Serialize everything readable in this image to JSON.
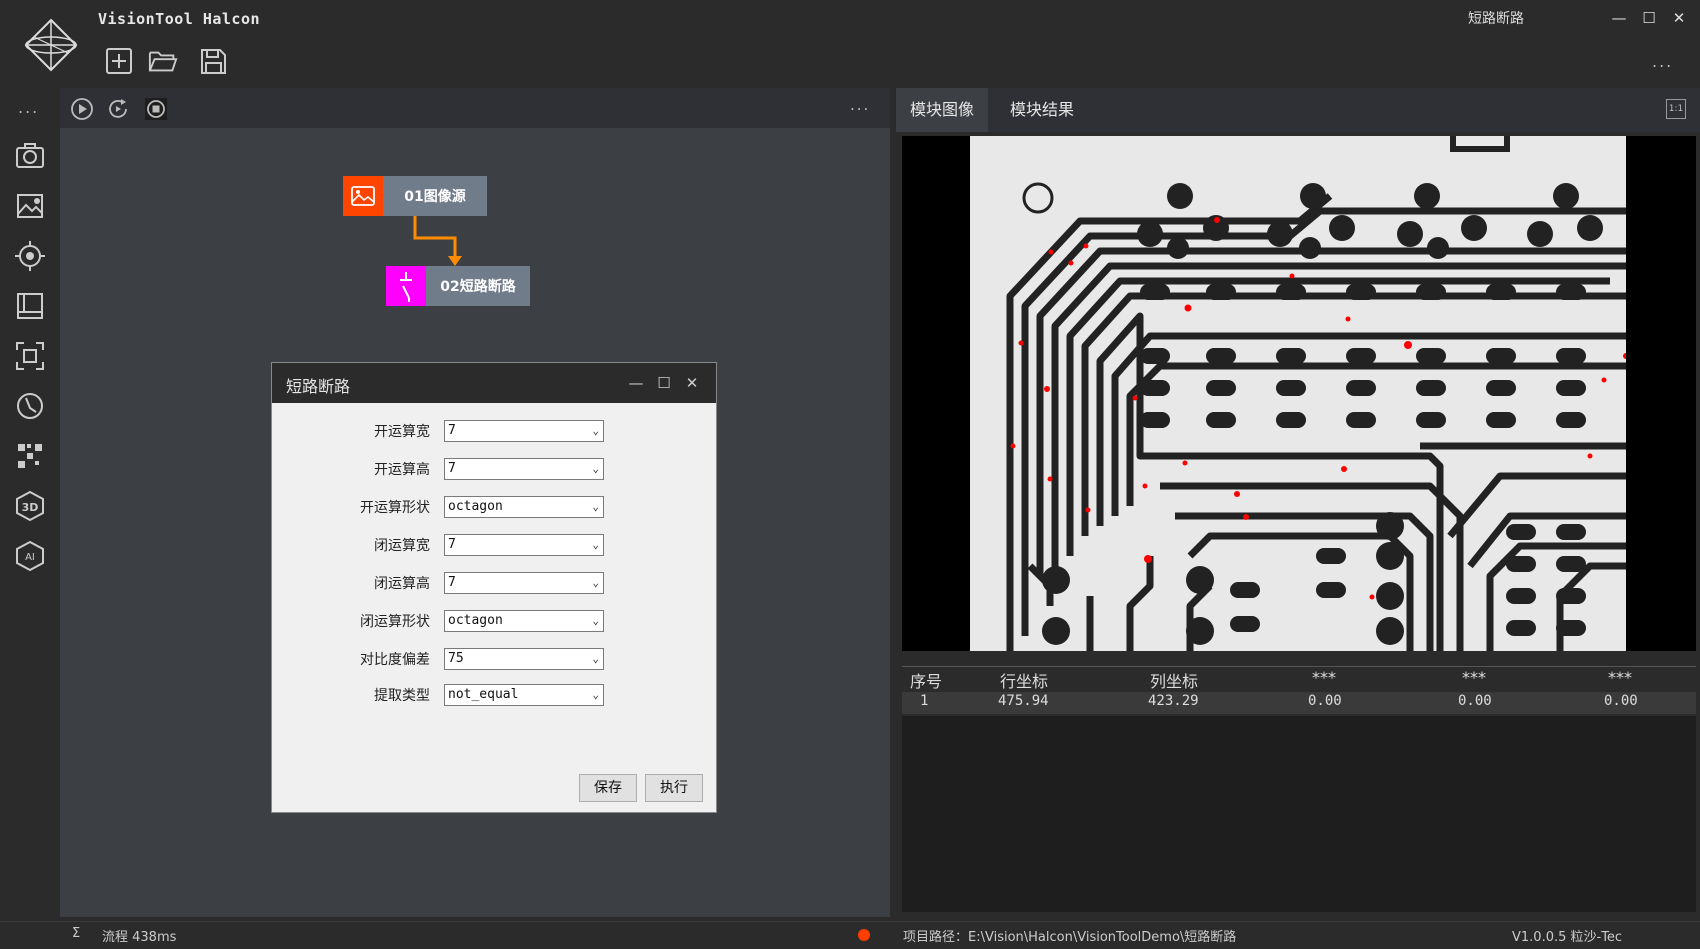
{
  "app": {
    "title": "VisionTool Halcon",
    "window_title": "短路断路"
  },
  "window_controls": {
    "minimize": "—",
    "maximize": "☐",
    "close": "✕"
  },
  "toolbar": {
    "more": "..."
  },
  "sidebar": {
    "more": "..."
  },
  "flow": {
    "more": "...",
    "nodes": [
      {
        "label": "01图像源",
        "color": "#ff4500"
      },
      {
        "label": "02短路断路",
        "color": "#ff00ff"
      }
    ]
  },
  "dialog": {
    "title": "短路断路",
    "controls": {
      "minimize": "—",
      "maximize": "☐",
      "close": "✕"
    },
    "rows": [
      {
        "label": "开运算宽",
        "value": "7"
      },
      {
        "label": "开运算高",
        "value": "7"
      },
      {
        "label": "开运算形状",
        "value": "octagon"
      },
      {
        "label": "闭运算宽",
        "value": "7"
      },
      {
        "label": "闭运算高",
        "value": "7"
      },
      {
        "label": "闭运算形状",
        "value": "octagon"
      },
      {
        "label": "对比度偏差",
        "value": "75"
      },
      {
        "label": "提取类型",
        "value": "not_equal"
      }
    ],
    "save": "保存",
    "execute": "执行",
    "arrow": "⌄"
  },
  "right": {
    "tabs": {
      "image": "模块图像",
      "result": "模块结果"
    },
    "ratio": "1:1",
    "table": {
      "headers": [
        "序号",
        "行坐标",
        "列坐标",
        "***",
        "***",
        "***"
      ],
      "rows": [
        [
          "1",
          "475.94",
          "423.29",
          "0.00",
          "0.00",
          "0.00"
        ]
      ]
    }
  },
  "status": {
    "sigma": "Σ",
    "flow": "流程 438ms",
    "path": "项目路径：E:\\Vision\\Halcon\\VisionToolDemo\\短路断路",
    "version": "V1.0.0.5 粒沙-Tec"
  },
  "colors": {
    "accent_orange": "#ff8c00",
    "status_dot": "#ff3d00",
    "defect": "#ff0000"
  }
}
